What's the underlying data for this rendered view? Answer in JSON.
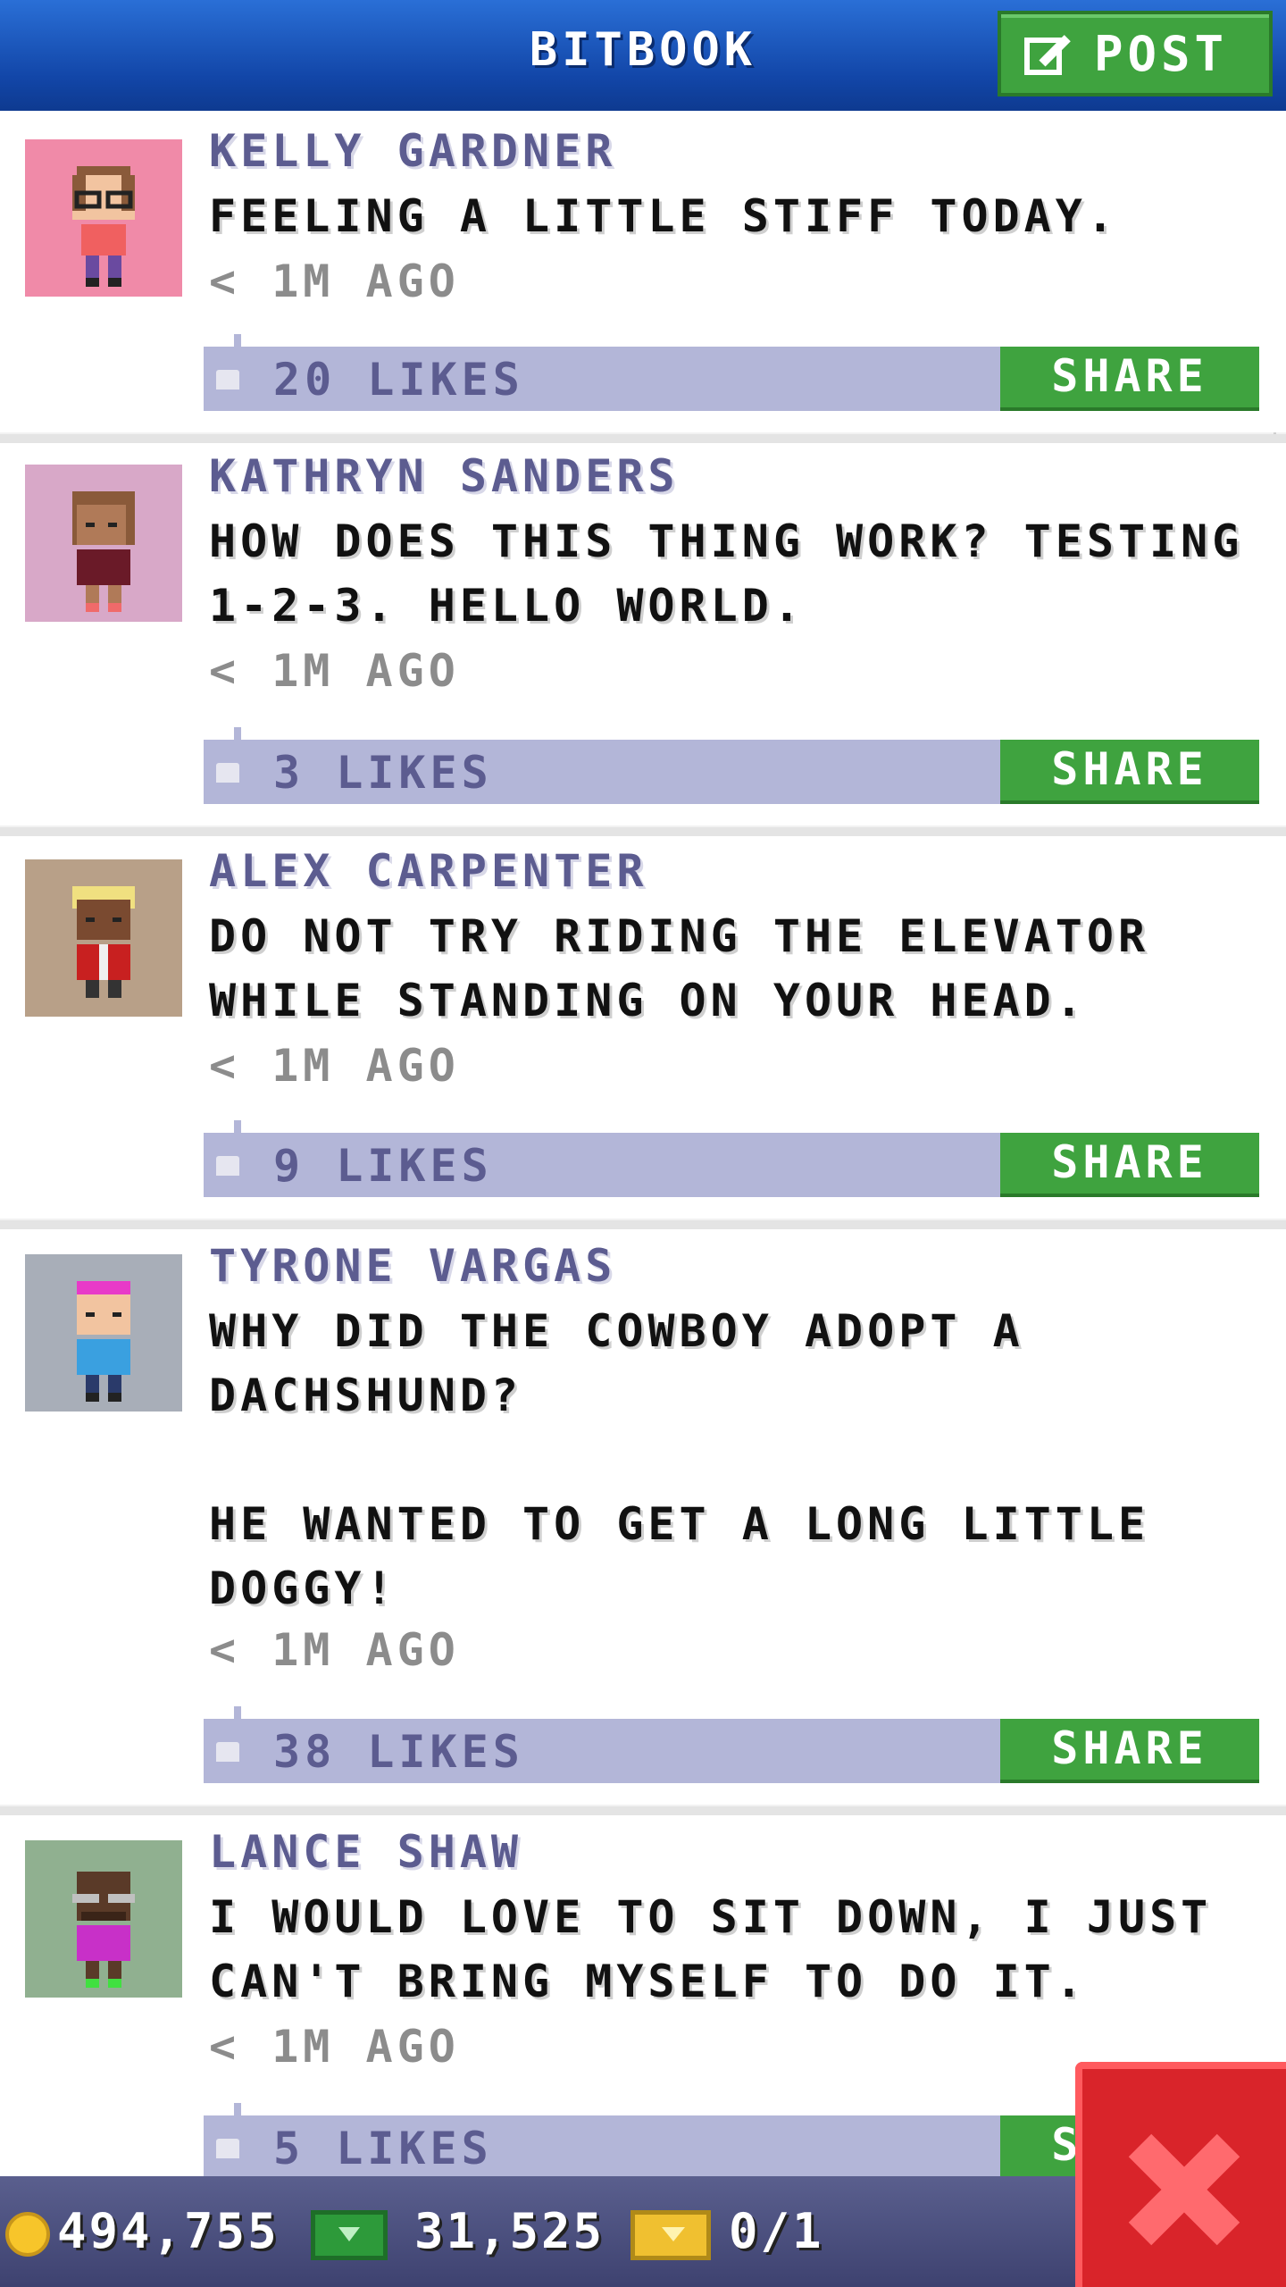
{
  "header": {
    "title": "BITBOOK",
    "post_label": "POST"
  },
  "posts": [
    {
      "name": "KELLY GARDNER",
      "message": "FEELING A LITTLE STIFF TODAY.",
      "time": "< 1M AGO",
      "likes": "20 LIKES",
      "share": "SHARE",
      "avatar_bg": "#f08aa8",
      "avatar_desc": "girl-with-glasses"
    },
    {
      "name": "KATHRYN SANDERS",
      "message": "HOW DOES THIS THING WORK? TESTING\n1-2-3. HELLO WORLD.",
      "time": "< 1M AGO",
      "likes": "3 LIKES",
      "share": "SHARE",
      "avatar_bg": "#d8a8c8",
      "avatar_desc": "woman-maroon"
    },
    {
      "name": "ALEX CARPENTER",
      "message": "DO NOT TRY RIDING THE ELEVATOR\nWHILE STANDING ON YOUR HEAD.",
      "time": "< 1M AGO",
      "likes": "9 LIKES",
      "share": "SHARE",
      "avatar_bg": "#b8a088",
      "avatar_desc": "man-blonde-red-vest"
    },
    {
      "name": "TYRONE VARGAS",
      "message": "WHY DID THE COWBOY ADOPT A\nDACHSHUND?\n\nHE WANTED TO GET A LONG LITTLE\nDOGGY!",
      "time": "< 1M AGO",
      "likes": "38 LIKES",
      "share": "SHARE",
      "avatar_bg": "#a8aeb8",
      "avatar_desc": "pink-hair-blue-shirt"
    },
    {
      "name": "LANCE SHAW",
      "message": "I WOULD LOVE TO SIT DOWN, I JUST\nCAN'T BRING MYSELF TO DO IT.",
      "time": "< 1M AGO",
      "likes": "5 LIKES",
      "share": "SHARE",
      "avatar_bg": "#90b090",
      "avatar_desc": "man-glasses-purple"
    }
  ],
  "status": {
    "coins": "494,755",
    "cash": "31,525",
    "tickets": "0/1"
  },
  "colors": {
    "header": "#1246a8",
    "green": "#3fa33f",
    "likes_bar": "#b3b6d8",
    "close": "#d9242a"
  }
}
